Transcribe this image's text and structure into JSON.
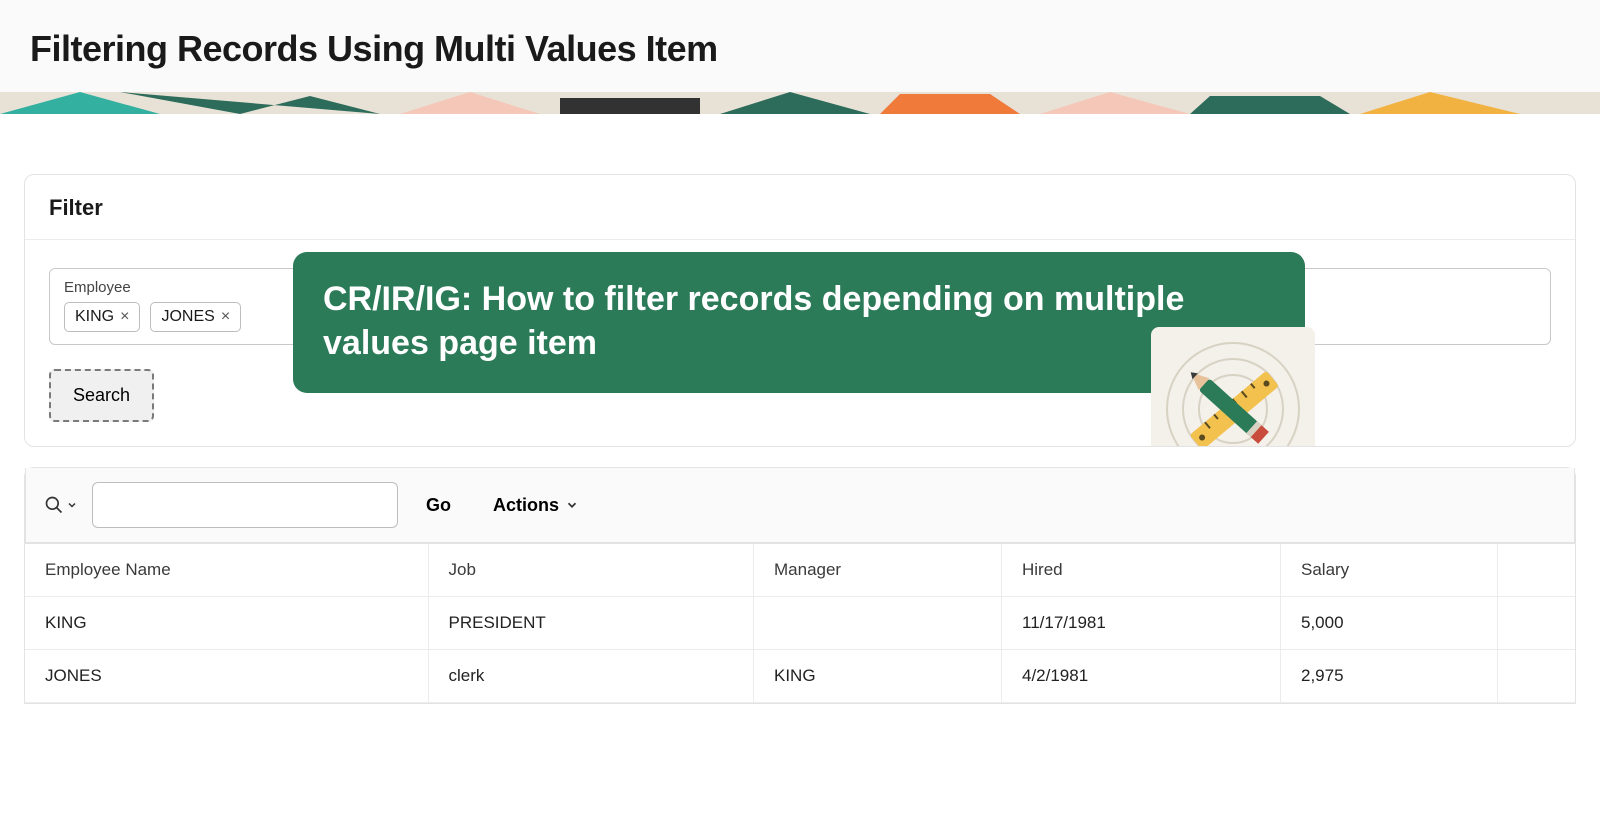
{
  "header": {
    "title": "Filtering Records Using Multi Values Item"
  },
  "filter": {
    "region_title": "Filter",
    "field_label": "Employee",
    "chips": [
      "KING",
      "JONES"
    ],
    "search_label": "Search"
  },
  "overlay": {
    "text": "CR/IR/IG: How to filter records depending on multiple values page item"
  },
  "report": {
    "go_label": "Go",
    "actions_label": "Actions",
    "columns": [
      "Employee Name",
      "Job",
      "Manager",
      "Hired",
      "Salary"
    ],
    "rows": [
      {
        "name": "KING",
        "job": "PRESIDENT",
        "manager": "",
        "hired": "11/17/1981",
        "salary": "5,000"
      },
      {
        "name": "JONES",
        "job": "clerk",
        "manager": "KING",
        "hired": "4/2/1981",
        "salary": "2,975"
      }
    ]
  }
}
